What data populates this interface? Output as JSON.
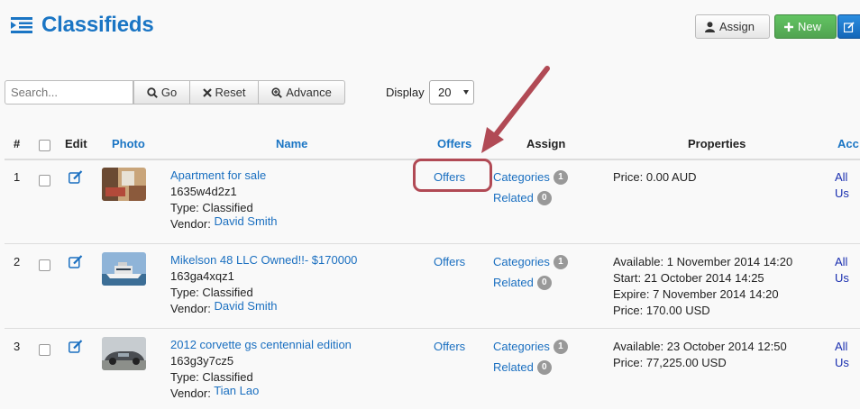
{
  "header": {
    "title": "Classifieds",
    "assign_label": "Assign",
    "new_label": "New"
  },
  "filters": {
    "search_placeholder": "Search...",
    "go_label": "Go",
    "reset_label": "Reset",
    "advance_label": "Advance",
    "display_label": "Display",
    "display_value": "20"
  },
  "table": {
    "headers": {
      "num": "#",
      "edit": "Edit",
      "photo": "Photo",
      "name": "Name",
      "offers": "Offers",
      "assign": "Assign",
      "properties": "Properties",
      "access": "Acc"
    },
    "rows": [
      {
        "num": "1",
        "name": "Apartment for sale",
        "code": "1635w4d2z1",
        "type": "Type: Classified",
        "vendor_label": "Vendor:",
        "vendor": "David Smith",
        "offers": "Offers",
        "categories": "Categories",
        "categories_count": "1",
        "related": "Related",
        "related_count": "0",
        "props": [
          "Price: 0.00 AUD"
        ],
        "access": "All Us"
      },
      {
        "num": "2",
        "name": "Mikelson 48 LLC Owned!!- $170000",
        "code": "163ga4xqz1",
        "type": "Type: Classified",
        "vendor_label": "Vendor:",
        "vendor": "David Smith",
        "offers": "Offers",
        "categories": "Categories",
        "categories_count": "1",
        "related": "Related",
        "related_count": "0",
        "props": [
          "Available: 1 November 2014 14:20",
          "Start: 21 October 2014 14:25",
          "Expire: 7 November 2014 14:20",
          "Price: 170.00 USD"
        ],
        "access": "All Us"
      },
      {
        "num": "3",
        "name": "2012 corvette gs centennial edition",
        "code": "163g3y7cz5",
        "type": "Type: Classified",
        "vendor_label": "Vendor:",
        "vendor": "Tian Lao",
        "offers": "Offers",
        "categories": "Categories",
        "categories_count": "1",
        "related": "Related",
        "related_count": "0",
        "props": [
          "Available: 23 October 2014 12:50",
          "Price: 77,225.00 USD"
        ],
        "access": "All Us"
      }
    ]
  },
  "colors": {
    "brand_blue": "#1a75c4",
    "link": "#1a6fc0",
    "new_green": "#51a351",
    "annotation": "#b14a55"
  }
}
